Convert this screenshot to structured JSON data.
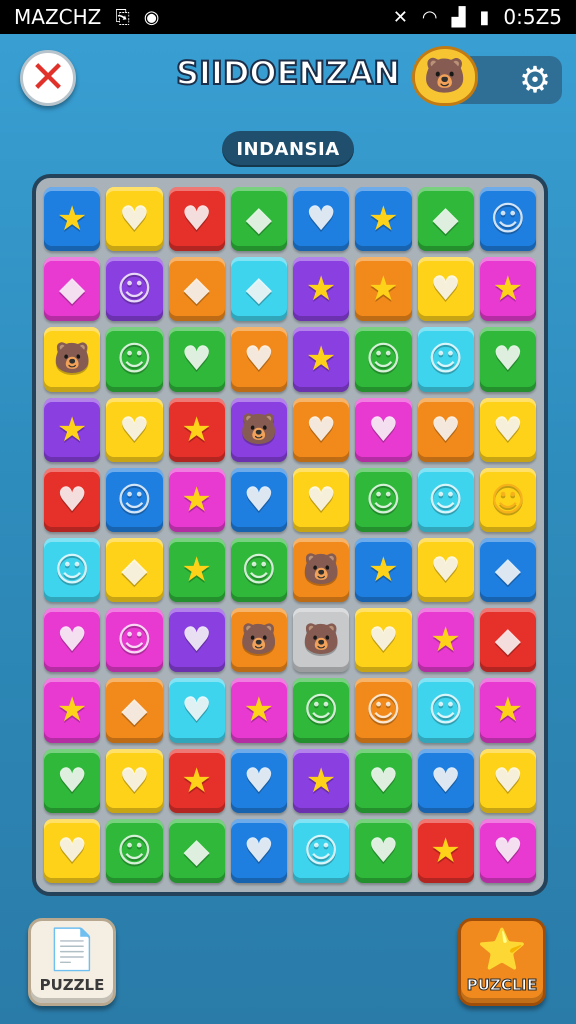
{
  "status_bar": {
    "carrier": "MAZCHZ",
    "time": "0:5Z5",
    "icons": [
      "notification-icon",
      "location-icon",
      "mute-icon",
      "wifi-icon",
      "signal-icon",
      "battery-icon"
    ]
  },
  "header": {
    "title": "SIIDOENZAN",
    "close_icon": "close-x-icon",
    "mascot_icon": "bear-mascot-icon",
    "settings_icon": "gear-icon"
  },
  "level_label": "INDANSIA",
  "board": {
    "rows": 10,
    "cols": 8,
    "tiles": [
      [
        "blue-star",
        "yellow-heart",
        "red-heart",
        "green-diamond",
        "blue-heart",
        "blue-star",
        "green-diamond",
        "blue-face"
      ],
      [
        "magenta-diamond",
        "purple-face",
        "orange-diamond",
        "cyan-diamond",
        "purple-star",
        "orange-star",
        "yellow-heart",
        "magenta-star"
      ],
      [
        "yellow-bear",
        "green-face",
        "green-heart",
        "orange-heart",
        "purple-star",
        "green-face",
        "cyan-face",
        "green-heart"
      ],
      [
        "purple-star",
        "yellow-heart",
        "red-star",
        "purple-bear",
        "orange-heart",
        "magenta-heart",
        "orange-heart",
        "yellow-heart"
      ],
      [
        "red-heart",
        "blue-face",
        "magenta-star",
        "blue-heart",
        "yellow-heart",
        "green-face",
        "cyan-face",
        "yellow-face"
      ],
      [
        "cyan-face",
        "yellow-diamond",
        "green-star",
        "green-face",
        "orange-bear",
        "blue-star",
        "yellow-heart",
        "blue-diamond"
      ],
      [
        "magenta-heart",
        "magenta-face",
        "purple-heart",
        "orange-bear",
        "gray-bear",
        "yellow-heart",
        "magenta-star",
        "red-diamond"
      ],
      [
        "magenta-star",
        "orange-diamond",
        "cyan-heart",
        "magenta-star",
        "green-face",
        "orange-face",
        "cyan-face",
        "magenta-star"
      ],
      [
        "green-heart",
        "yellow-heart",
        "red-star",
        "blue-heart",
        "purple-star",
        "green-heart",
        "blue-heart",
        "yellow-heart"
      ],
      [
        "yellow-heart",
        "green-face",
        "green-diamond",
        "blue-heart",
        "cyan-face",
        "green-heart",
        "red-star",
        "magenta-heart"
      ]
    ]
  },
  "colors": {
    "blue": "#1f7fe0",
    "yellow": "#ffd21a",
    "red": "#e6302a",
    "green": "#2fb83a",
    "magenta": "#e83ad0",
    "purple": "#8a3fe0",
    "orange": "#f28a1b",
    "cyan": "#3fd4ee",
    "gray": "#c7c9cb"
  },
  "bottom_buttons": {
    "left": {
      "label": "PUZZLE",
      "icon": "document-icon"
    },
    "right": {
      "label": "PUZCLIE",
      "icon": "star-icon"
    }
  }
}
